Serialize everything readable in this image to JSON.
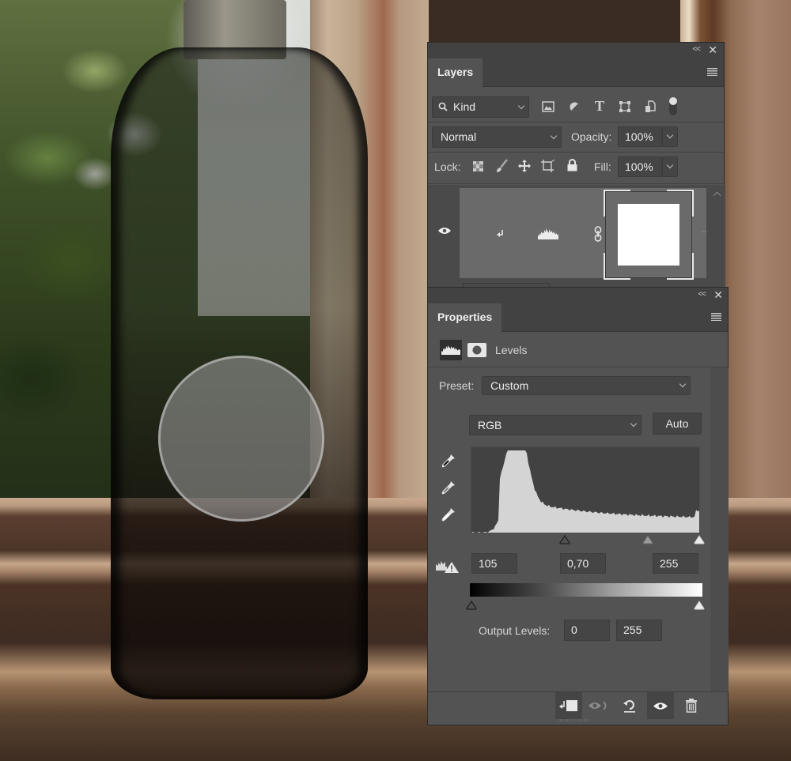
{
  "layers_panel": {
    "collapse_label": "<<",
    "close_label": "✕",
    "tab_label": "Layers",
    "filter": {
      "selected": "Kind",
      "icons": [
        "image-filter-icon",
        "adjustment-filter-icon",
        "type-filter-icon",
        "shape-filter-icon",
        "smart-object-filter-icon",
        "filter-toggle-icon"
      ]
    },
    "blend_mode": "Normal",
    "opacity_label": "Opacity:",
    "opacity_value": "100%",
    "lock_label": "Lock:",
    "fill_label": "Fill:",
    "fill_value": "100%",
    "layer": {
      "visible": true,
      "type": "Levels adjustment layer",
      "clipped": true,
      "more_label": "··"
    }
  },
  "properties_panel": {
    "collapse_label": "<<",
    "close_label": "✕",
    "tab_label": "Properties",
    "section_title": "Levels",
    "preset_label": "Preset:",
    "preset_value": "Custom",
    "channel_value": "RGB",
    "auto_label": "Auto",
    "input_levels": {
      "black": "105",
      "gamma": "0,70",
      "white": "255"
    },
    "output_label": "Output Levels:",
    "output_levels": {
      "black": "0",
      "white": "255"
    },
    "footer_buttons": [
      "clip-to-layer-button",
      "view-previous-state-button",
      "reset-button",
      "toggle-visibility-button",
      "delete-button"
    ]
  },
  "colors": {
    "panel_bg": "#535353",
    "panel_header": "#424242",
    "field_bg": "#454545",
    "histogram_fill": "#d4d4d4",
    "text": "#e6e6e6"
  }
}
